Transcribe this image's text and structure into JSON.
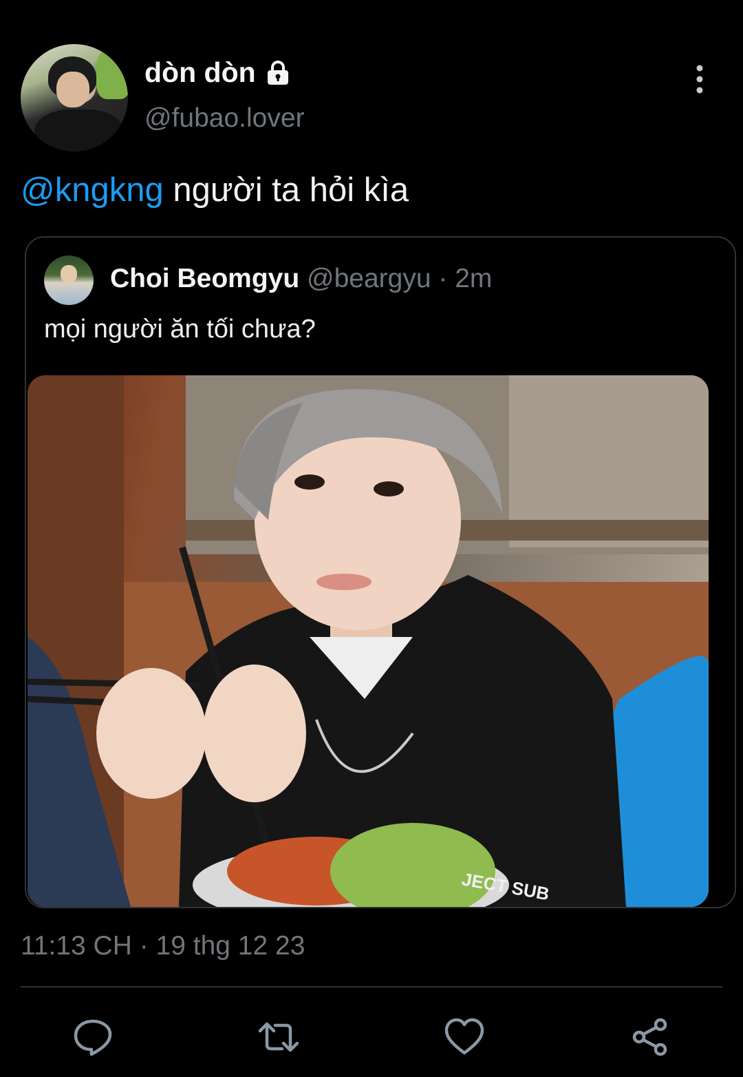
{
  "author": {
    "display_name": "dòn dòn",
    "handle": "@fubao.lover",
    "protected_icon": "lock-icon"
  },
  "tweet": {
    "mention": "@kngkng",
    "text": " người ta hỏi kìa",
    "timestamp": "11:13 CH · 19 thg 12 23"
  },
  "quote": {
    "name": "Choi Beomgyu",
    "meta": " @beargyu · 2m",
    "text": "mọi người ăn tối chưa?",
    "photo_text": "JECT SUB"
  },
  "actions": [
    {
      "icon": "reply-icon"
    },
    {
      "icon": "retweet-icon"
    },
    {
      "icon": "like-icon"
    },
    {
      "icon": "share-icon"
    }
  ],
  "colors": {
    "background": "#000000",
    "link": "#1d9bf0",
    "secondary": "#71767b",
    "border": "#2f3336"
  }
}
